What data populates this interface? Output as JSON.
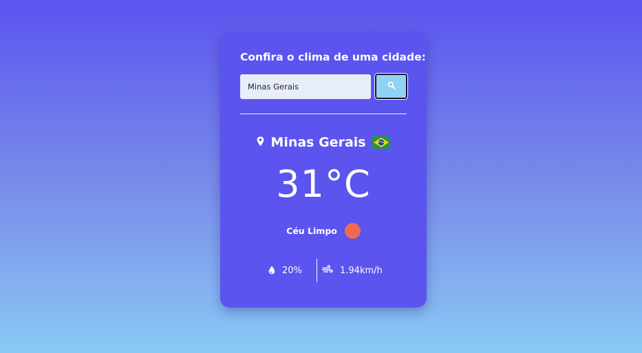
{
  "search": {
    "heading": "Confira o clima de uma cidade:",
    "input_value": "Minas Gerais",
    "button_icon": "search-icon"
  },
  "weather": {
    "city": "Minas Gerais",
    "location_icon": "map-pin-icon",
    "country_flag": "brazil-flag-icon",
    "temperature": "31°C",
    "description": "Céu Limpo",
    "condition_icon": "sun-icon",
    "humidity": "20%",
    "humidity_icon": "droplet-icon",
    "wind": "1.94km/h",
    "wind_icon": "wind-icon"
  },
  "colors": {
    "card": "#5b54ee",
    "button": "#8fd2f5",
    "input": "#e8edfc",
    "sun": "#ee6b52",
    "gradient_top": "#5b54ee",
    "gradient_bottom": "#89c9f4"
  }
}
